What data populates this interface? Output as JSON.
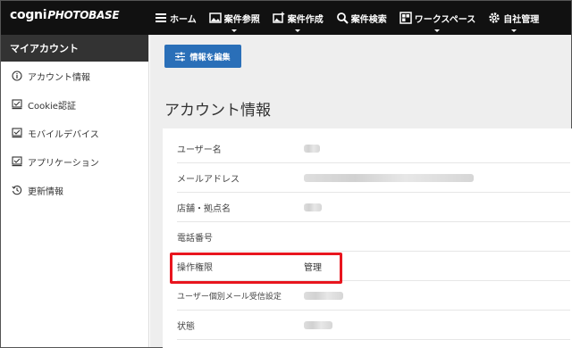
{
  "header": {
    "logo_brand": "cogni",
    "logo_sub": "PHOTOBASE",
    "nav": [
      {
        "label": "ホーム",
        "icon": "menu-icon"
      },
      {
        "label": "案件参照",
        "icon": "image-icon"
      },
      {
        "label": "案件作成",
        "icon": "image-add-icon"
      },
      {
        "label": "案件検索",
        "icon": "search-icon"
      },
      {
        "label": "ワークスペース",
        "icon": "workspace-icon"
      },
      {
        "label": "自社管理",
        "icon": "gear-icon"
      }
    ]
  },
  "sidebar": {
    "title": "マイアカウント",
    "items": [
      {
        "label": "アカウント情報",
        "icon": "info-icon"
      },
      {
        "label": "Cookie認証",
        "icon": "checkbox-icon"
      },
      {
        "label": "モバイルデバイス",
        "icon": "checkbox-icon"
      },
      {
        "label": "アプリケーション",
        "icon": "checkbox-icon"
      },
      {
        "label": "更新情報",
        "icon": "history-icon"
      }
    ]
  },
  "main": {
    "edit_button": "情報を編集",
    "section_title": "アカウント情報",
    "fields": [
      {
        "label": "ユーザー名",
        "value": ""
      },
      {
        "label": "メールアドレス",
        "value": ""
      },
      {
        "label": "店舗・拠点名",
        "value": ""
      },
      {
        "label": "電話番号",
        "value": ""
      },
      {
        "label": "操作権限",
        "value": "管理"
      },
      {
        "label": "ユーザー個別メール受信設定",
        "value": ""
      },
      {
        "label": "状態",
        "value": ""
      }
    ]
  },
  "colors": {
    "topbar": "#111111",
    "sidebar_header": "#333333",
    "primary_button": "#2a6fb8",
    "highlight": "#e8151e",
    "content_bg": "#eeeeee"
  }
}
